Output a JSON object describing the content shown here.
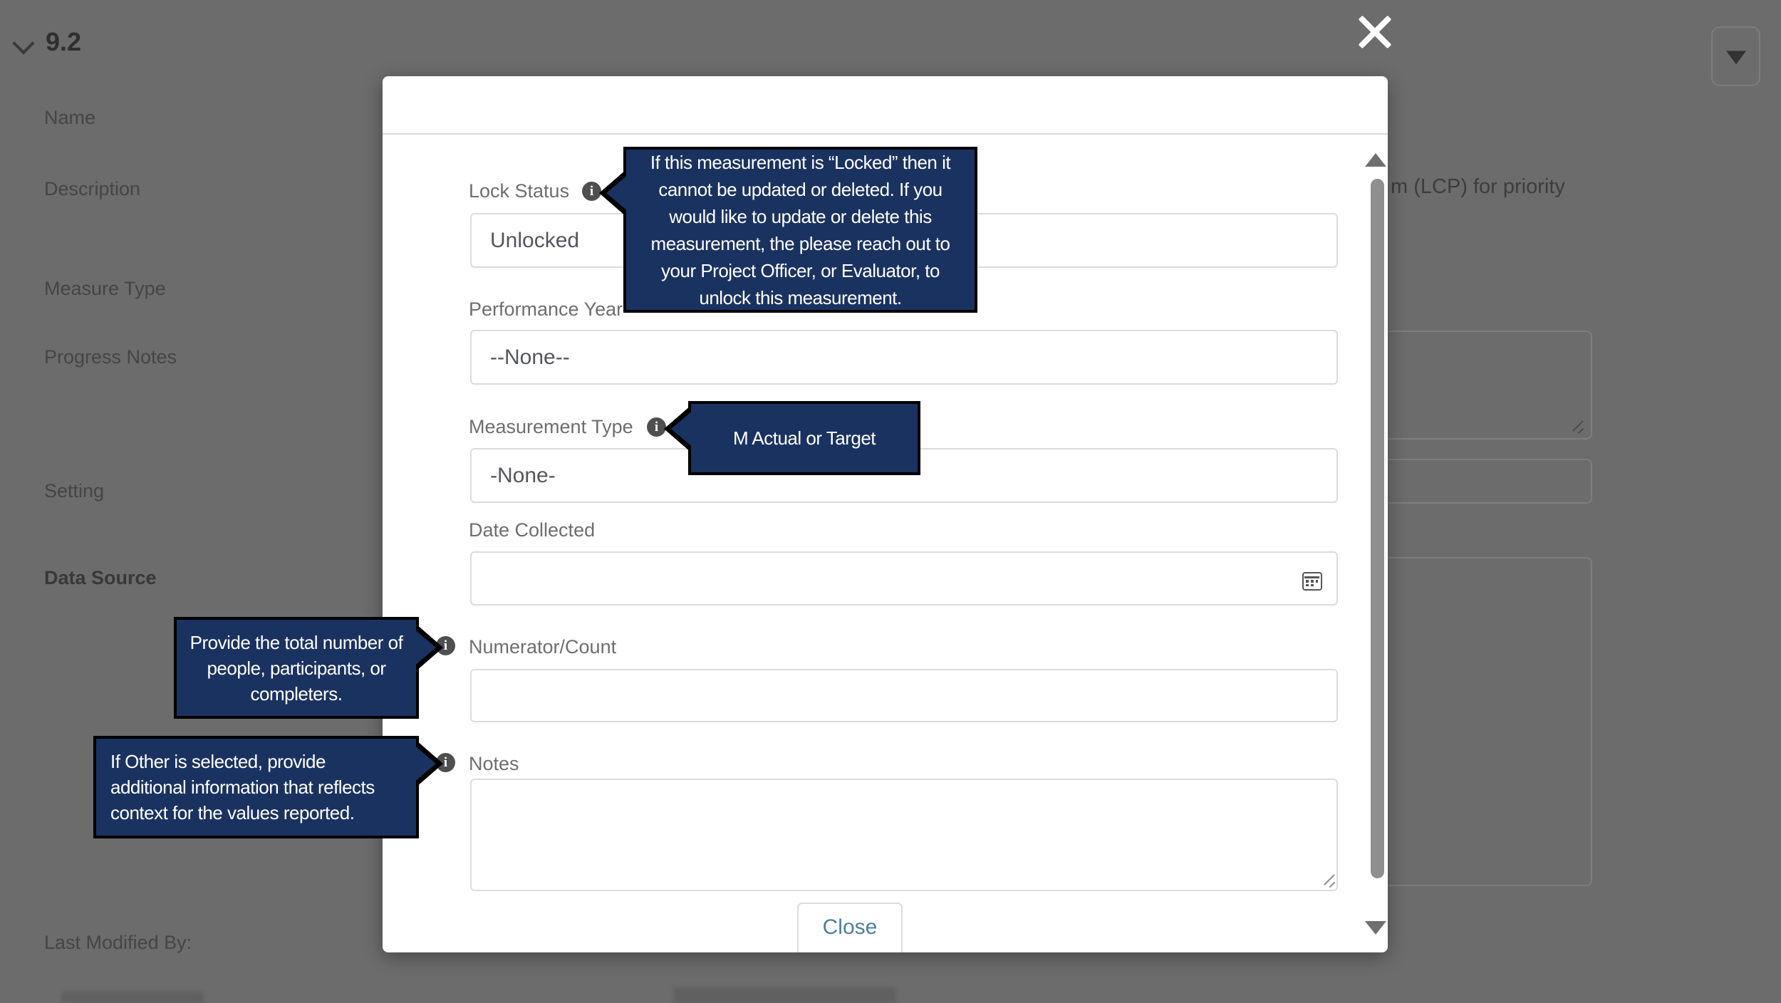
{
  "background_page": {
    "section_header": "9.2",
    "labels": {
      "name": "Name",
      "description": "Description",
      "measure_type": "Measure Type",
      "progress_notes": "Progress Notes",
      "setting": "Setting",
      "data_source": "Data Source",
      "last_modified_by": "Last Modified By:"
    },
    "right_text_fragment": "m (LCP) for priority"
  },
  "modal": {
    "fields": {
      "lock_status": {
        "label": "Lock Status",
        "value": "Unlocked"
      },
      "performance_year": {
        "label": "Performance Year",
        "value": "--None--"
      },
      "measurement_type": {
        "label": "Measurement Type",
        "value": "-None-"
      },
      "date_collected": {
        "label": "Date Collected",
        "value": ""
      },
      "numerator": {
        "label": "Numerator/Count",
        "value": ""
      },
      "notes": {
        "label": "Notes",
        "value": ""
      }
    },
    "close_button_label": "Close"
  },
  "tooltips": {
    "lock_status": "If this measurement is “Locked” then it cannot be updated or deleted. If you would like to update or delete this measurement, the please reach out to your Project Officer, or Evaluator, to unlock this measurement.",
    "measurement_type": "M Actual or Target",
    "numerator": "Provide the total number of people, participants, or completers.",
    "notes": "If Other is selected, provide additional information that reflects context for the values reported."
  },
  "icons": {
    "info": "i"
  },
  "colors": {
    "overlay_gray": "#6c6c6c",
    "tooltip_navy": "#1a3260",
    "tooltip_border": "#000000",
    "close_button_text": "#4f7f95",
    "modal_background": "#ffffff",
    "field_border": "#dcdcdc",
    "label_gray": "#6e6e6e",
    "info_icon_bg": "#4f4f4f"
  }
}
